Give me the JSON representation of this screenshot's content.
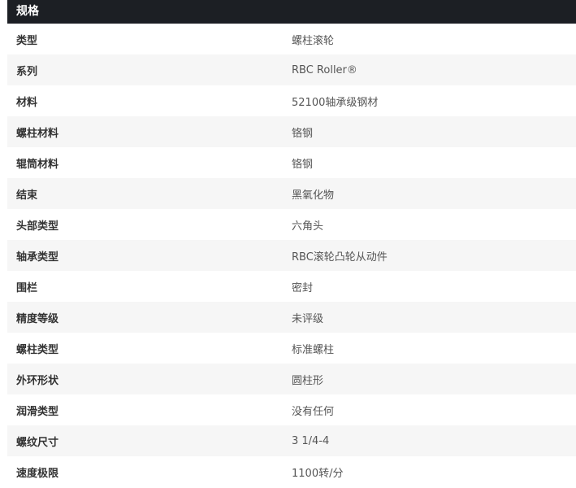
{
  "spec": {
    "title": "规格",
    "rows": [
      {
        "label": "类型",
        "value": "螺柱滚轮"
      },
      {
        "label": "系列",
        "value": "RBC Roller®"
      },
      {
        "label": "材料",
        "value": "52100轴承级钢材"
      },
      {
        "label": "螺柱材料",
        "value": "铬钢"
      },
      {
        "label": "辊筒材料",
        "value": "铬钢"
      },
      {
        "label": "结束",
        "value": "黑氧化物"
      },
      {
        "label": "头部类型",
        "value": "六角头"
      },
      {
        "label": "轴承类型",
        "value": "RBC滚轮凸轮从动件"
      },
      {
        "label": "围栏",
        "value": "密封"
      },
      {
        "label": "精度等级",
        "value": "未评级"
      },
      {
        "label": "螺柱类型",
        "value": "标准螺柱"
      },
      {
        "label": "外环形状",
        "value": "圆柱形"
      },
      {
        "label": "润滑类型",
        "value": "没有任何"
      },
      {
        "label": "螺纹尺寸",
        "value": "3 1/4-4"
      },
      {
        "label": "速度极限",
        "value": "1100转/分"
      }
    ]
  }
}
